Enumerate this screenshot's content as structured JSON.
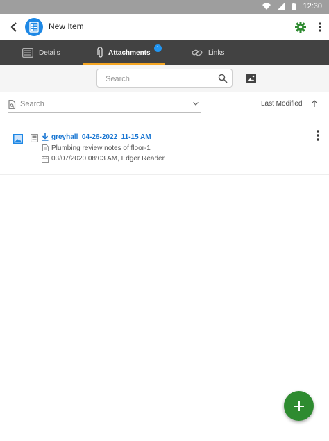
{
  "status_bar": {
    "time": "12:30"
  },
  "app_bar": {
    "title": "New Item"
  },
  "tabs": [
    {
      "label": "Details",
      "icon": "details-icon"
    },
    {
      "label": "Attachments",
      "icon": "paperclip-icon",
      "badge": "1",
      "active": true
    },
    {
      "label": "Links",
      "icon": "link-icon"
    }
  ],
  "search": {
    "placeholder": "Search"
  },
  "filter": {
    "label": "Search",
    "sort_label": "Last Modified",
    "sort_direction": "ascending"
  },
  "attachments": [
    {
      "name": "greyhall_04-26-2022_11-15 AM",
      "description": "Plumbing review notes of floor-1",
      "date": "03/07/2020  08:03 AM, Edger Reader"
    }
  ],
  "colors": {
    "accent": "#f5a623",
    "primary": "#1e88e5",
    "fab": "#2e8b30",
    "tab_bar": "#424242",
    "link": "#1976d2",
    "badge": "#2196f3"
  }
}
